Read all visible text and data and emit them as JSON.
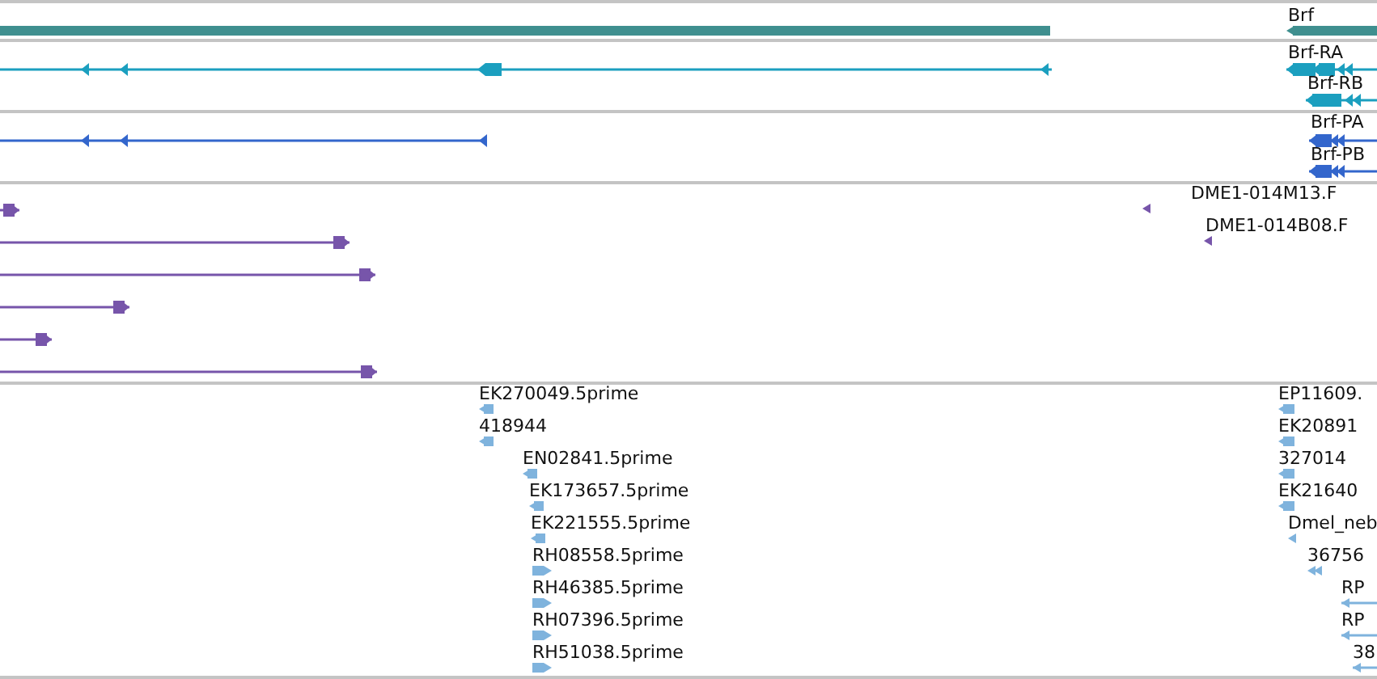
{
  "tracks": [
    {
      "kind": "gene",
      "features": [
        {
          "label": "Brf"
        }
      ]
    },
    {
      "kind": "transcript",
      "features": [
        {
          "label": "Brf-RA"
        },
        {
          "label": "Brf-RB"
        }
      ]
    },
    {
      "kind": "protein",
      "features": [
        {
          "label": "Brf-PA"
        },
        {
          "label": "Brf-PB"
        }
      ]
    },
    {
      "kind": "clone",
      "features": [
        {
          "label": "DME1-014M13.F"
        },
        {
          "label": "DME1-014B08.F"
        }
      ]
    },
    {
      "kind": "est",
      "features": [
        {
          "label": "EK270049.5prime"
        },
        {
          "label": "418944"
        },
        {
          "label": "EN02841.5prime"
        },
        {
          "label": "EK173657.5prime"
        },
        {
          "label": "EK221555.5prime"
        },
        {
          "label": "RH08558.5prime"
        },
        {
          "label": "RH46385.5prime"
        },
        {
          "label": "RH07396.5prime"
        },
        {
          "label": "RH51038.5prime"
        },
        {
          "label": "EP11609."
        },
        {
          "label": "EK20891"
        },
        {
          "label": "327014"
        },
        {
          "label": "EK21640"
        },
        {
          "label": "Dmel_neb"
        },
        {
          "label": "36756"
        },
        {
          "label": "RP"
        },
        {
          "label": "RP"
        },
        {
          "label": "38"
        }
      ]
    }
  ]
}
